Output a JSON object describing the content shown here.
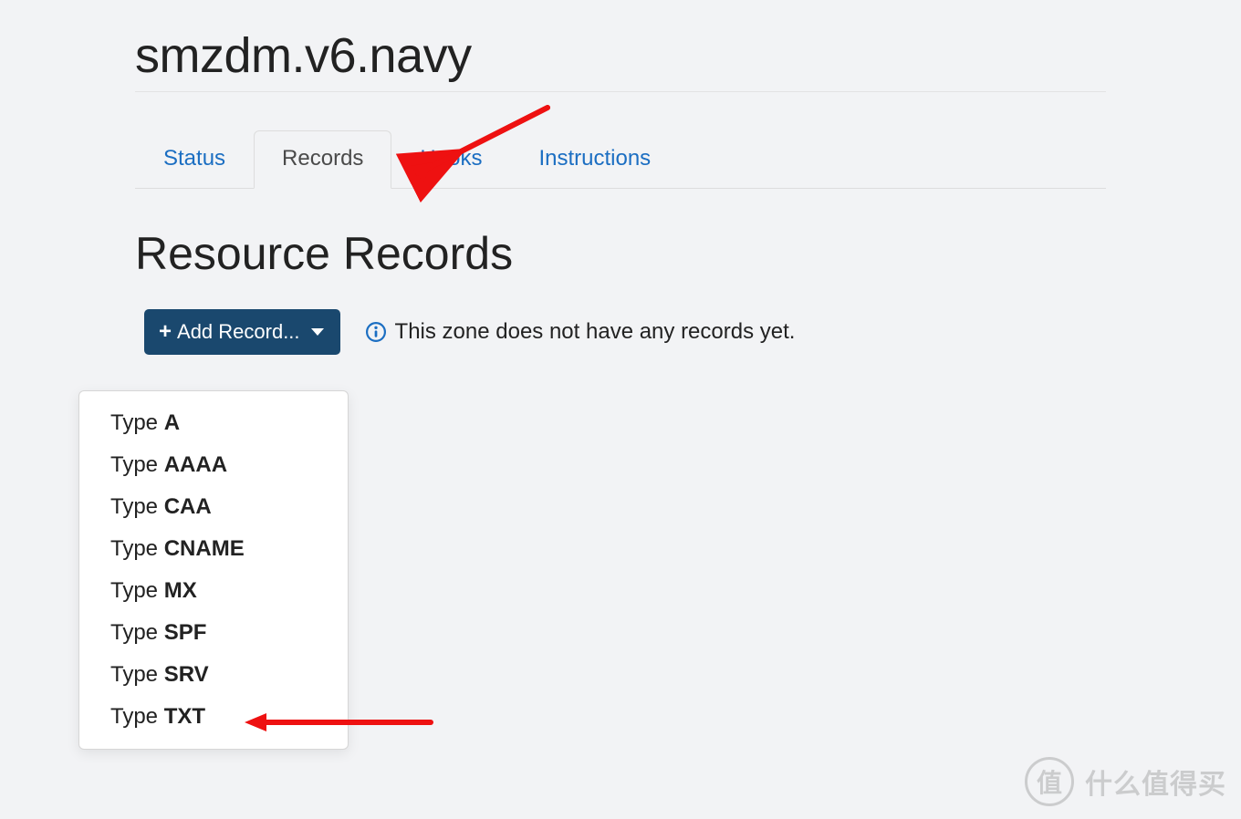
{
  "page": {
    "title": "smzdm.v6.navy"
  },
  "tabs": [
    {
      "label": "Status",
      "active": false
    },
    {
      "label": "Records",
      "active": true
    },
    {
      "label": "Hooks",
      "active": false
    },
    {
      "label": "Instructions",
      "active": false
    }
  ],
  "section": {
    "title": "Resource Records"
  },
  "toolbar": {
    "add_record_label": "Add Record..."
  },
  "empty_state": {
    "message": "This zone does not have any records yet."
  },
  "dropdown": {
    "prefix": "Type",
    "types": [
      "A",
      "AAAA",
      "CAA",
      "CNAME",
      "MX",
      "SPF",
      "SRV",
      "TXT"
    ]
  },
  "watermark": {
    "badge": "值",
    "text": "什么值得买"
  }
}
